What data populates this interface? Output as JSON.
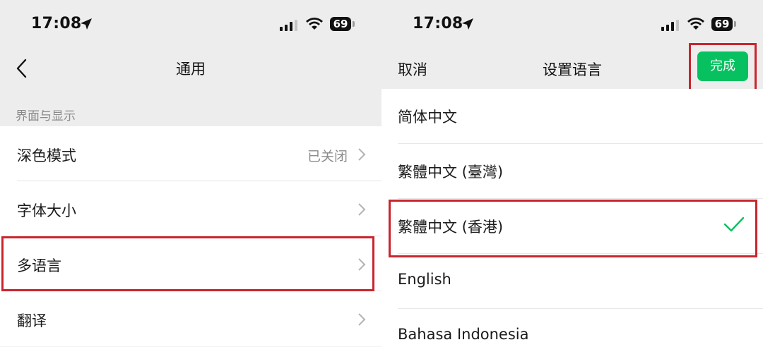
{
  "left": {
    "status": {
      "time": "17:08",
      "battery": "69"
    },
    "nav": {
      "title": "通用"
    },
    "section_header": "界面与显示",
    "rows": [
      {
        "label": "深色模式",
        "value": "已关闭"
      },
      {
        "label": "字体大小",
        "value": ""
      },
      {
        "label": "多语言",
        "value": ""
      },
      {
        "label": "翻译",
        "value": ""
      }
    ]
  },
  "right": {
    "status": {
      "time": "17:08",
      "battery": "69"
    },
    "nav": {
      "cancel": "取消",
      "title": "设置语言",
      "done": "完成"
    },
    "languages": [
      {
        "label": "简体中文",
        "selected": false
      },
      {
        "label": "繁體中文 (臺灣)",
        "selected": false
      },
      {
        "label": "繁體中文 (香港)",
        "selected": true
      },
      {
        "label": "English",
        "selected": false
      },
      {
        "label": "Bahasa Indonesia",
        "selected": false
      }
    ]
  },
  "colors": {
    "accent": "#07c160",
    "highlight": "#c9252d",
    "header_bg": "#ededed"
  }
}
